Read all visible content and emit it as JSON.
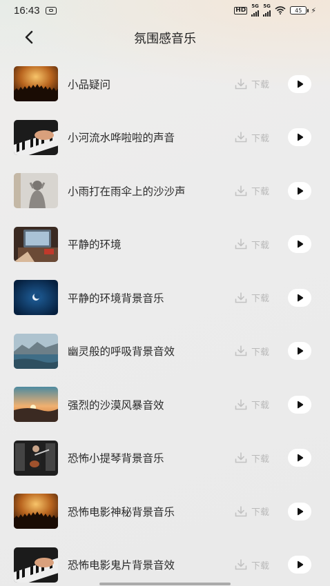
{
  "status_bar": {
    "time": "16:43",
    "hd_label": "HD",
    "sim1_label": "5G",
    "sim2_label": "5G",
    "battery": "45"
  },
  "header": {
    "title": "氛围感音乐"
  },
  "download_label": "下载",
  "items": [
    {
      "title": "小品疑问",
      "thumb": "concert-crowd"
    },
    {
      "title": "小河流水哗啦啦的声音",
      "thumb": "piano-hands"
    },
    {
      "title": "小雨打在雨伞上的沙沙声",
      "thumb": "person-behind-glass"
    },
    {
      "title": "平静的环境",
      "thumb": "desk-laptop"
    },
    {
      "title": "平静的环境背景音乐",
      "thumb": "moon-night"
    },
    {
      "title": "幽灵般的呼吸背景音效",
      "thumb": "lake-mountains"
    },
    {
      "title": "强烈的沙漠风暴音效",
      "thumb": "sunset-hills"
    },
    {
      "title": "恐怖小提琴背景音乐",
      "thumb": "guitar-player"
    },
    {
      "title": "恐怖电影神秘背景音乐",
      "thumb": "concert-crowd"
    },
    {
      "title": "恐怖电影鬼片背景音效",
      "thumb": "piano-hands"
    }
  ]
}
